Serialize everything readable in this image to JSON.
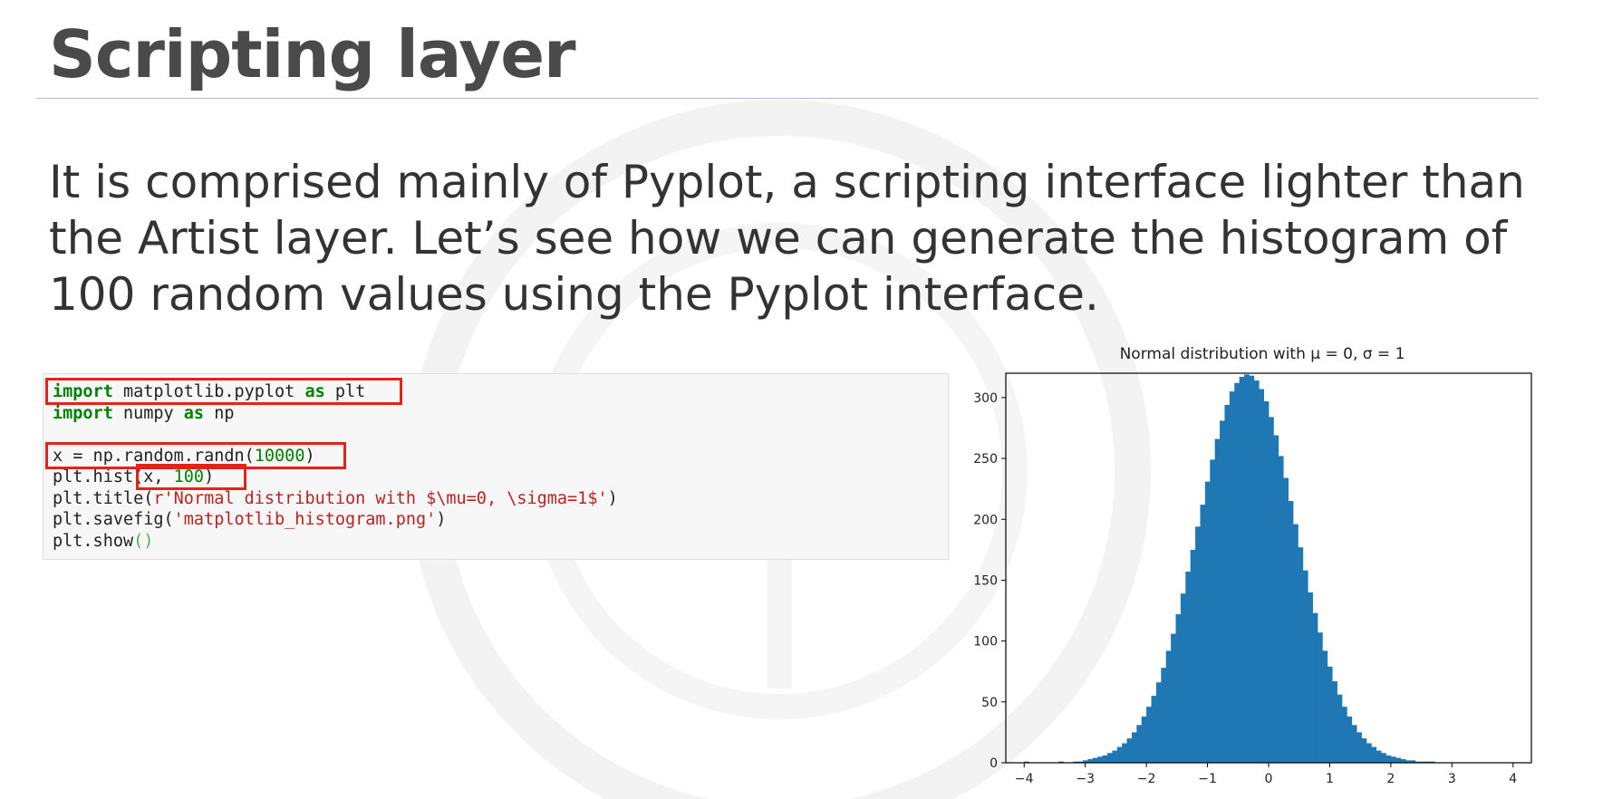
{
  "slide": {
    "title": "Scripting layer",
    "body": "It is comprised mainly of Pyplot, a scripting interface lighter than the Artist layer. Let’s see how we can generate the histogram of 100 random values using the Pyplot interface."
  },
  "code": {
    "line1": {
      "kw1": "import",
      "mid": " matplotlib.pyplot ",
      "kw2": "as",
      "end": " plt"
    },
    "line2": {
      "kw1": "import",
      "mid": " numpy ",
      "kw2": "as",
      "end": " np"
    },
    "line4": {
      "pre": "x = np.random.randn(",
      "num": "10000",
      "post": ")"
    },
    "line5": {
      "pre": "plt.hist(x, ",
      "num": "100",
      "post": ")"
    },
    "line6": {
      "pre": "plt.title(",
      "str": "r'Normal distribution with $\\mu=0, \\sigma=1$'",
      "post": ")"
    },
    "line7": {
      "pre": "plt.savefig(",
      "str": "'matplotlib_histogram.png'",
      "post": ")"
    },
    "line8": {
      "pre": "plt.show",
      "paren": "()"
    }
  },
  "colors": {
    "bar": "#1f77b4",
    "highlight": "#e2231a",
    "keyword": "#008000",
    "string": "#ba2121"
  },
  "chart_data": {
    "type": "bar",
    "title": "Normal distribution with μ = 0, σ = 1",
    "xlabel": "",
    "ylabel": "",
    "xlim": [
      -4.3,
      4.3
    ],
    "ylim": [
      0,
      320
    ],
    "xticks": [
      -4,
      -3,
      -2,
      -1,
      0,
      1,
      2,
      3,
      4
    ],
    "yticks": [
      0,
      50,
      100,
      150,
      200,
      250,
      300
    ],
    "bin_edges_range": [
      -4.0,
      4.0
    ],
    "bin_count": 100,
    "values": [
      1,
      0,
      0,
      0,
      0,
      0,
      0,
      1,
      0,
      0,
      1,
      1,
      2,
      3,
      4,
      5,
      6,
      8,
      10,
      13,
      16,
      20,
      25,
      31,
      38,
      46,
      55,
      66,
      78,
      92,
      106,
      122,
      139,
      157,
      175,
      194,
      212,
      231,
      249,
      266,
      281,
      294,
      305,
      312,
      317,
      319,
      318,
      314,
      307,
      297,
      284,
      269,
      252,
      234,
      215,
      196,
      177,
      158,
      140,
      123,
      107,
      92,
      79,
      67,
      56,
      46,
      38,
      31,
      25,
      20,
      16,
      13,
      10,
      8,
      6,
      5,
      4,
      3,
      2,
      2,
      1,
      1,
      1,
      1,
      0,
      0,
      0,
      0,
      0,
      0,
      0,
      0,
      0,
      0,
      0,
      0,
      0,
      0,
      0,
      0
    ]
  }
}
